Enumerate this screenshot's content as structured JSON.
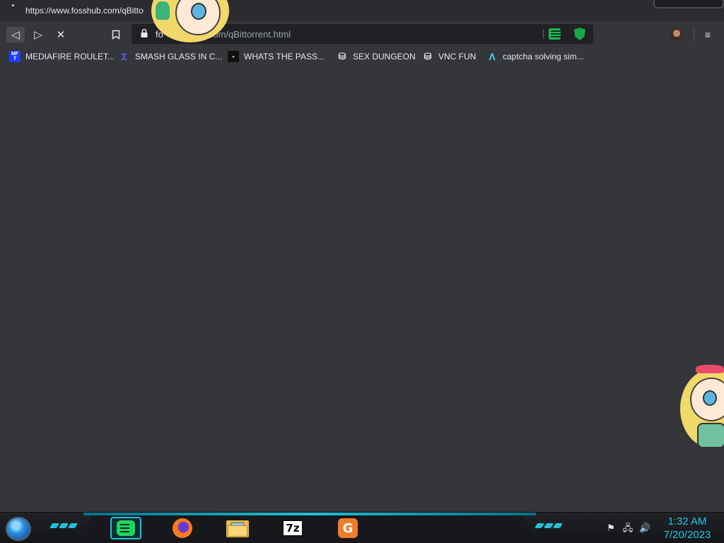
{
  "status_tip": {
    "url": "https://www.fosshub.com/qBitto"
  },
  "toolbar": {
    "address_host": "fo",
    "address_path": "com/qBittorrent.html",
    "back_icon": "back-arrow-icon",
    "forward_icon": "forward-arrow-icon",
    "stop_icon": "stop-loading-icon",
    "bookmark_icon": "bookmark-icon",
    "menu_icon": "kebab-menu-icon",
    "glyphs": {
      "back": "◁",
      "forward": "▷",
      "stop": "✕",
      "menu": "≡"
    }
  },
  "bookmarks": [
    {
      "label": "MEDIAFIRE ROULET...",
      "icon": "mediafire-icon",
      "fav_text": "MF\nT",
      "fav_bg": "#1a3cff",
      "fav_color": "#ffffff"
    },
    {
      "label": "SMASH GLASS IN C...",
      "icon": "sigma-icon",
      "fav_text": "Σ",
      "fav_bg": "#35363a",
      "fav_color": "#5b5bff"
    },
    {
      "label": "WHATS THE PASS...",
      "icon": "dark-site-icon",
      "fav_text": "▪",
      "fav_bg": "#111111",
      "fav_color": "#cccccc"
    },
    {
      "label": "SEX DUNGEON",
      "icon": "vnc-icon",
      "fav_text": "⛁",
      "fav_bg": "#35363a",
      "fav_color": "#e0e0e0"
    },
    {
      "label": "VNC FUN",
      "icon": "vnc-icon",
      "fav_text": "⛁",
      "fav_bg": "#35363a",
      "fav_color": "#e0e0e0"
    },
    {
      "label": "captcha solving sim...",
      "icon": "captcha-icon",
      "fav_text": "Λ",
      "fav_bg": "#35363a",
      "fav_color": "#3de0e8"
    }
  ],
  "taskbar": {
    "apps": [
      {
        "name": "spotify",
        "icon": "spotify-icon",
        "active": true
      },
      {
        "name": "firefox",
        "icon": "firefox-icon",
        "active": false
      },
      {
        "name": "file-explorer",
        "icon": "folder-icon",
        "active": false
      },
      {
        "name": "7zip",
        "icon": "7zip-icon",
        "label": "7z",
        "active": false
      },
      {
        "name": "gdownloader",
        "icon": "g-download-icon",
        "label": "G",
        "active": false
      }
    ],
    "tray_glyphs": {
      "flag": "⚑",
      "network": "🖧",
      "volume": "🔊"
    },
    "time": "1:32 AM",
    "date": "7/20/2023"
  },
  "colors": {
    "page_bg": "#35363a",
    "accent_cyan": "#23c0d8",
    "clock": "#23c6e6"
  }
}
